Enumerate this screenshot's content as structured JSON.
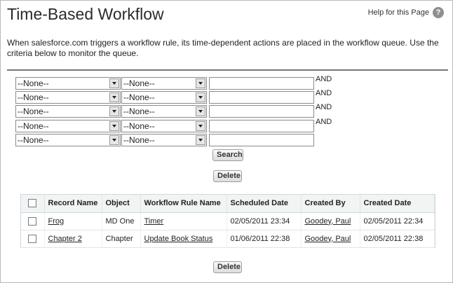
{
  "page": {
    "title": "Time-Based Workflow",
    "help_link": "Help for this Page",
    "help_icon": "?",
    "description": "When salesforce.com triggers a workflow rule, its time-dependent actions are placed in the workflow queue. Use the criteria below to monitor the queue."
  },
  "criteria": {
    "rows": [
      {
        "field": "--None--",
        "operator": "--None--",
        "value": "",
        "conj": "AND"
      },
      {
        "field": "--None--",
        "operator": "--None--",
        "value": "",
        "conj": "AND"
      },
      {
        "field": "--None--",
        "operator": "--None--",
        "value": "",
        "conj": "AND"
      },
      {
        "field": "--None--",
        "operator": "--None--",
        "value": "",
        "conj": "AND"
      },
      {
        "field": "--None--",
        "operator": "--None--",
        "value": "",
        "conj": ""
      }
    ],
    "search_label": "Search"
  },
  "actions": {
    "delete_label": "Delete"
  },
  "table": {
    "headers": {
      "record_name": "Record Name",
      "object": "Object",
      "workflow_rule_name": "Workflow Rule Name",
      "scheduled_date": "Scheduled Date",
      "created_by": "Created By",
      "created_date": "Created Date"
    },
    "rows": [
      {
        "record_name": "Frog",
        "object": "MD One",
        "workflow_rule_name": "Timer",
        "scheduled_date": "02/05/2011 23:34",
        "created_by": "Goodey, Paul",
        "created_date": "02/05/2011 22:34"
      },
      {
        "record_name": "Chapter 2",
        "object": "Chapter",
        "workflow_rule_name": "Update Book Status",
        "scheduled_date": "01/06/2011 22:38",
        "created_by": "Goodey, Paul",
        "created_date": "02/05/2011 22:38"
      }
    ]
  }
}
